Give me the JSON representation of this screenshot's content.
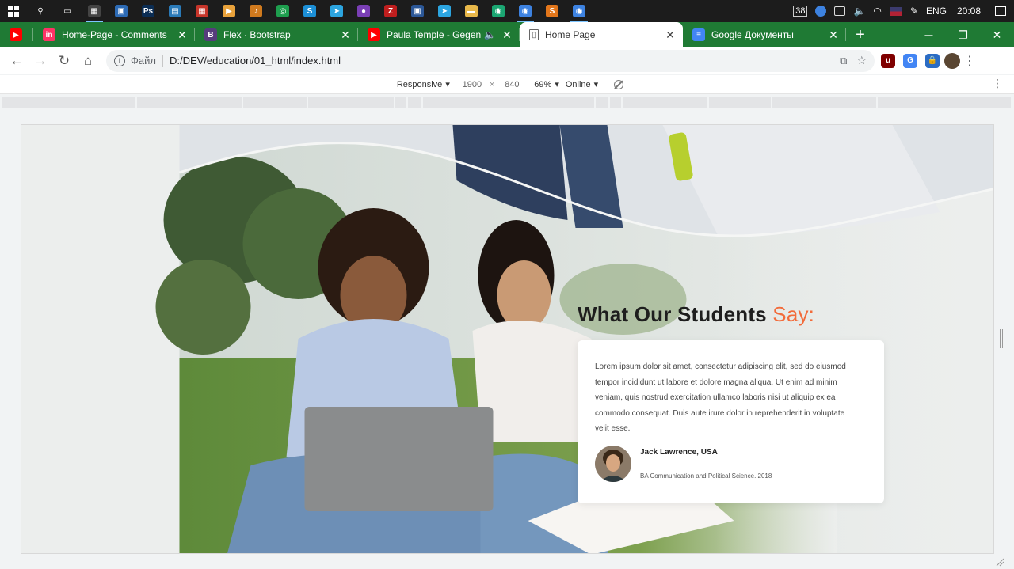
{
  "taskbar": {
    "icons": [
      {
        "name": "search-icon",
        "glyph": "⚲",
        "color": "#1c1c1c"
      },
      {
        "name": "task-view-icon",
        "glyph": "▭",
        "color": "#1c1c1c"
      },
      {
        "name": "calculator-icon",
        "glyph": "▦",
        "color": "#444"
      },
      {
        "name": "app-icon",
        "glyph": "▣",
        "color": "#2d6bb5"
      },
      {
        "name": "photoshop-icon",
        "glyph": "Ps",
        "color": "#0b2d54"
      },
      {
        "name": "app-icon",
        "glyph": "▤",
        "color": "#2a7ab8"
      },
      {
        "name": "app-icon",
        "glyph": "▦",
        "color": "#c7352a"
      },
      {
        "name": "media-player-icon",
        "glyph": "▶",
        "color": "#e9a23b"
      },
      {
        "name": "music-icon",
        "glyph": "♪",
        "color": "#d07a1e"
      },
      {
        "name": "app-icon",
        "glyph": "◎",
        "color": "#1e9e4e"
      },
      {
        "name": "skype-icon",
        "glyph": "S",
        "color": "#1c8fd6"
      },
      {
        "name": "telegram-icon",
        "glyph": "➤",
        "color": "#2ca5e0"
      },
      {
        "name": "app-icon",
        "glyph": "●",
        "color": "#7a3fb5"
      },
      {
        "name": "filezilla-icon",
        "glyph": "Z",
        "color": "#bf1e1e"
      },
      {
        "name": "app-icon",
        "glyph": "▣",
        "color": "#2b5797"
      },
      {
        "name": "telegram-icon",
        "glyph": "➤",
        "color": "#2ca5e0"
      },
      {
        "name": "folder-icon",
        "glyph": "▬",
        "color": "#e8b84a"
      },
      {
        "name": "app-icon",
        "glyph": "◉",
        "color": "#1ba672"
      },
      {
        "name": "chrome-icon",
        "glyph": "◉",
        "color": "#3d82e0"
      },
      {
        "name": "sublime-icon",
        "glyph": "S",
        "color": "#e2761b"
      },
      {
        "name": "chrome-icon",
        "glyph": "◉",
        "color": "#3d82e0"
      }
    ],
    "tray_count": "38",
    "language": "ENG",
    "clock": "20:08"
  },
  "tabs": [
    {
      "label": "",
      "favicon": "▶",
      "color": "#ff0000",
      "active": false
    },
    {
      "label": "Home-Page - Comments",
      "favicon": "in",
      "color": "#ff3366",
      "active": false
    },
    {
      "label": "Flex · Bootstrap",
      "favicon": "B",
      "color": "#563d7c",
      "active": false
    },
    {
      "label": "Paula Temple - Gegen - Y",
      "favicon": "▶",
      "color": "#ff0000",
      "active": false,
      "audio": "🔈"
    },
    {
      "label": "Home Page",
      "favicon": "▯",
      "color": "#ffffff",
      "active": true
    },
    {
      "label": "Google Документы",
      "favicon": "≡",
      "color": "#4285f4",
      "active": false
    }
  ],
  "toolbar": {
    "scheme": "Файл",
    "url": "D:/DEV/education/01_html/index.html",
    "extensions": [
      {
        "name": "ublock-icon",
        "glyph": "u",
        "color": "#800000"
      },
      {
        "name": "translate-icon",
        "glyph": "G",
        "color": "#4285f4"
      },
      {
        "name": "lock-extension-icon",
        "glyph": "🔒",
        "color": "#2b6cc4"
      }
    ]
  },
  "devtools": {
    "device": "Responsive",
    "width": "1900",
    "height": "840",
    "zoom": "69%",
    "network": "Online"
  },
  "page": {
    "heading_main": "What Our Students",
    "heading_accent": "Say:",
    "quote": "Lorem ipsum dolor sit amet, consectetur adipiscing elit, sed do eiusmod tempor incididunt ut labore et dolore magna aliqua. Ut enim ad minim veniam, quis nostrud exercitation ullamco laboris nisi ut aliquip ex ea commodo consequat. Duis aute irure dolor in reprehenderit in voluptate velit esse.",
    "author_name": "Jack Lawrence, USA",
    "author_title": "BA Communication and Political Science. 2018",
    "accent_color": "#f26b3a"
  }
}
